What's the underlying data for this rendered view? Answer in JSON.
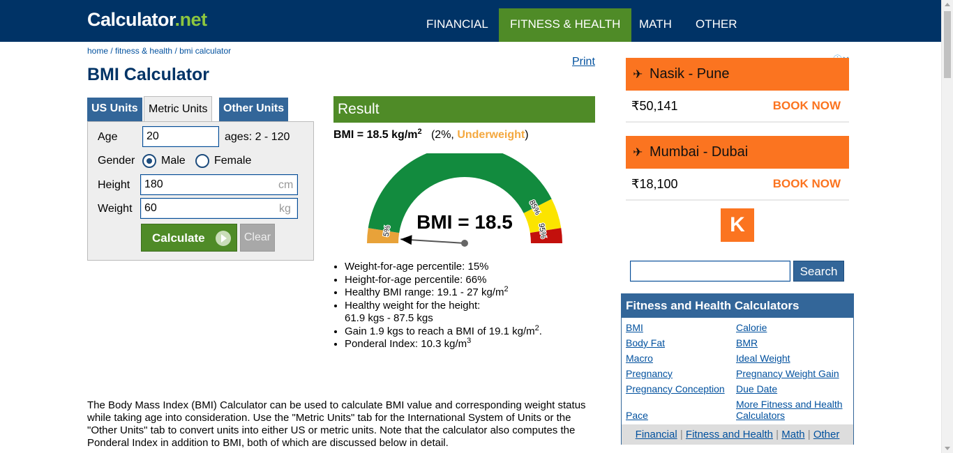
{
  "header": {
    "logo_main": "Calculator",
    "logo_dot": ".",
    "logo_ext": "net",
    "nav": [
      "FINANCIAL",
      "FITNESS & HEALTH",
      "MATH",
      "OTHER"
    ]
  },
  "breadcrumb": [
    "home",
    "fitness & health",
    "bmi calculator"
  ],
  "breadcrumb_sep": " / ",
  "page_title": "BMI Calculator",
  "print_label": "Print",
  "unit_tabs": [
    "US Units",
    "Metric Units",
    "Other Units"
  ],
  "form": {
    "age_label": "Age",
    "age_value": "20",
    "age_hint": "ages: 2 - 120",
    "gender_label": "Gender",
    "gender_male": "Male",
    "gender_female": "Female",
    "gender_selected": "Male",
    "height_label": "Height",
    "height_value": "180",
    "height_unit": "cm",
    "weight_label": "Weight",
    "weight_value": "60",
    "weight_unit": "kg",
    "calculate_label": "Calculate",
    "clear_label": "Clear"
  },
  "result": {
    "header": "Result",
    "bmi_text": "BMI = 18.5 kg/m",
    "bmi_sup": "2",
    "percentile_text": "(2%, ",
    "category": "Underweight",
    "close_paren": ")",
    "gauge_label": "BMI = 18.5",
    "gauge_ticks": [
      "5%",
      "85%",
      "95%"
    ],
    "gauge_colors": {
      "underweight": "#e8a239",
      "healthy": "#128b3e",
      "overweight": "#fbe400",
      "obese": "#c3100c"
    },
    "bmi_percentile": 2,
    "list": [
      {
        "text": "Weight-for-age percentile: 15%",
        "sup": ""
      },
      {
        "text": "Height-for-age percentile: 66%",
        "sup": ""
      },
      {
        "text": "Healthy BMI range: 19.1 - 27 kg/m",
        "sup": "2"
      },
      {
        "text": "Healthy weight for the height:",
        "line2": "61.9 kgs - 87.5 kgs",
        "sup": ""
      },
      {
        "text": "Gain 1.9 kgs to reach a BMI of 19.1 kg/m",
        "sup": "2",
        "after": "."
      },
      {
        "text": "Ponderal Index: 10.3 kg/m",
        "sup": "3"
      }
    ]
  },
  "description": "The Body Mass Index (BMI) Calculator can be used to calculate BMI value and corresponding weight status while taking age into consideration. Use the \"Metric Units\" tab for the International System of Units or the \"Other Units\" tab to convert units into either US or metric units. Note that the calculator also computes the Ponderal Index in addition to BMI, both of which are discussed below in detail.",
  "ads": [
    {
      "route": "Nasik - Pune",
      "price": "₹50,141",
      "cta": "BOOK NOW"
    },
    {
      "route": "Mumbai - Dubai",
      "price": "₹18,100",
      "cta": "BOOK NOW"
    }
  ],
  "ad_logo": "K",
  "search_label": "Search",
  "fitness_box": {
    "title": "Fitness and Health Calculators",
    "left": [
      "BMI",
      "Body Fat",
      "Macro",
      "Pregnancy",
      "Pregnancy Conception",
      "Pace"
    ],
    "right": [
      "Calorie",
      "BMR",
      "Ideal Weight",
      "Pregnancy Weight Gain",
      "Due Date",
      "More Fitness and Health Calculators"
    ],
    "footer": [
      "Financial",
      "Fitness and Health",
      "Math",
      "Other"
    ],
    "footer_sep": " | "
  }
}
